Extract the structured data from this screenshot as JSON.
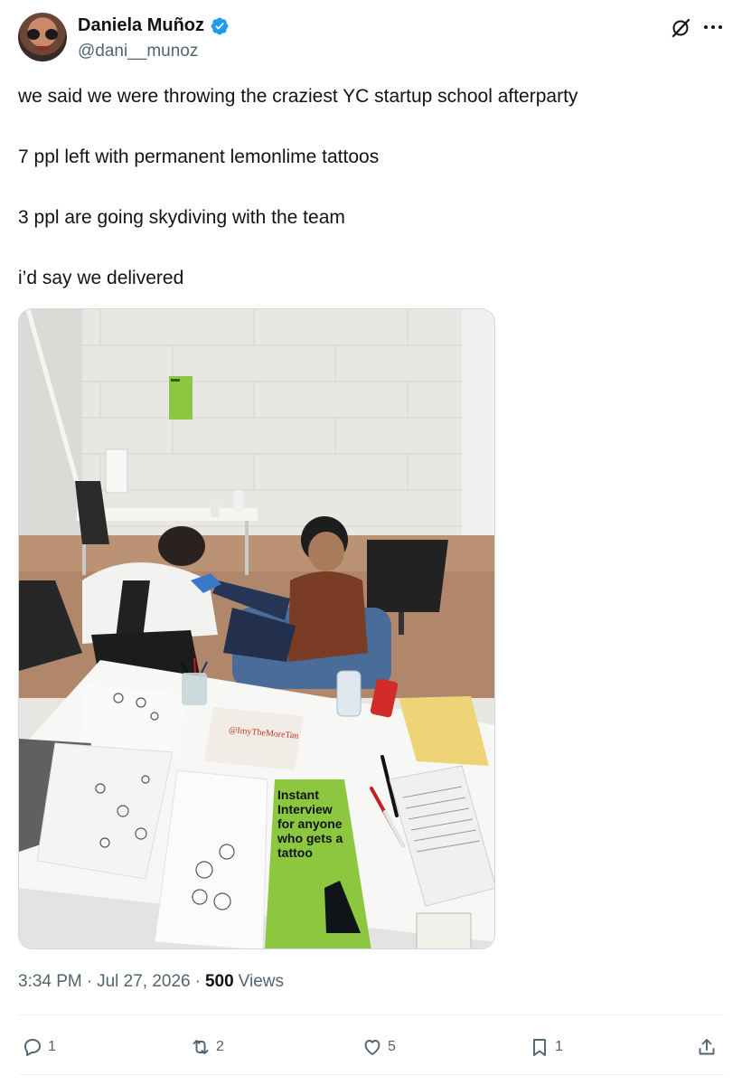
{
  "author": {
    "display_name": "Daniela Muñoz",
    "handle": "@dani__munoz",
    "verified": true
  },
  "tweet": {
    "lines": [
      "we said we were throwing the craziest YC startup school afterparty",
      "7 ppl left with permanent lemonlime tattoos",
      "3 ppl are going skydiving with the team",
      "i’d say we delivered"
    ],
    "time": "3:34 PM",
    "date": "Jul 27, 2026",
    "separator": "·",
    "views_count": "500",
    "views_label": "Views"
  },
  "media": {
    "poster_text": [
      "Instant",
      "Interview",
      "for anyone",
      "who gets a",
      "tattoo"
    ],
    "paper_handle": "@ImyTheMoreTan",
    "sticker_text": "Instant Interview for anyone who gets a tattoo"
  },
  "actions": {
    "replies": "1",
    "reposts": "2",
    "likes": "5",
    "bookmarks": "1"
  },
  "colors": {
    "text_primary": "#0f1419",
    "text_secondary": "#536471",
    "verified_blue": "#1d9bf0",
    "poster_green": "#8dc63f",
    "divider": "#eff3f4"
  }
}
